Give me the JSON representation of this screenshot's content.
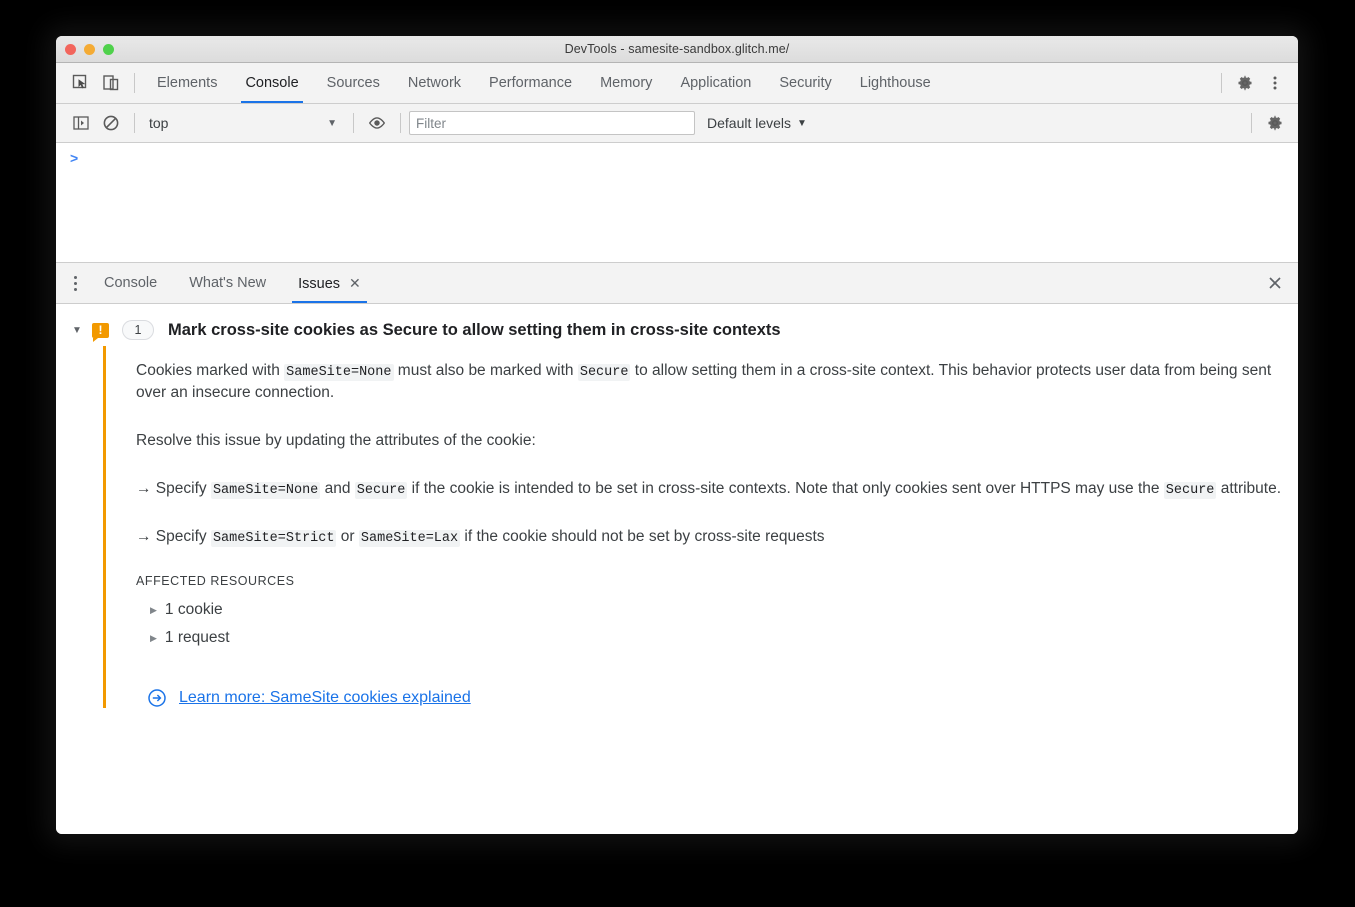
{
  "window": {
    "title": "DevTools - samesite-sandbox.glitch.me/",
    "traffic_lights": [
      "close",
      "minimize",
      "maximize"
    ],
    "colors": {
      "accent_blue": "#1a73e8",
      "warning_orange": "#f29900",
      "link_blue": "#1a73e8",
      "chrome_gray": "#f3f3f3"
    }
  },
  "main_tabs": {
    "inspect_icon": "inspect-cursor-icon",
    "device_icon": "device-toolbar-icon",
    "items": [
      {
        "label": "Elements",
        "active": false
      },
      {
        "label": "Console",
        "active": true
      },
      {
        "label": "Sources",
        "active": false
      },
      {
        "label": "Network",
        "active": false
      },
      {
        "label": "Performance",
        "active": false
      },
      {
        "label": "Memory",
        "active": false
      },
      {
        "label": "Application",
        "active": false
      },
      {
        "label": "Security",
        "active": false
      },
      {
        "label": "Lighthouse",
        "active": false
      }
    ],
    "settings_icon": "gear-icon",
    "more_icon": "vertical-dots-icon"
  },
  "console_toolbar": {
    "sidebar_icon": "console-sidebar-icon",
    "clear_icon": "clear-console-icon",
    "context": "top",
    "context_caret": "▼",
    "eye_icon": "live-expression-eye-icon",
    "filter_placeholder": "Filter",
    "filter_value": "",
    "levels": "Default levels",
    "levels_caret": "▼",
    "settings_icon": "gear-icon"
  },
  "console_area": {
    "prompt": ">"
  },
  "drawer": {
    "menu_icon": "vertical-dots-icon",
    "tabs": [
      {
        "label": "Console",
        "active": false,
        "closable": false
      },
      {
        "label": "What's New",
        "active": false,
        "closable": false
      },
      {
        "label": "Issues",
        "active": true,
        "closable": true,
        "close_glyph": "✕"
      }
    ],
    "close_drawer_glyph": "✕"
  },
  "issue": {
    "disclosure_glyph": "▼",
    "severity_icon": "warning-badge-icon",
    "severity_glyph": "!",
    "count": "1",
    "title": "Mark cross-site cookies as Secure to allow setting them in cross-site contexts",
    "paragraph1": {
      "part1": "Cookies marked with ",
      "code1": "SameSite=None",
      "part2": " must also be marked with ",
      "code2": "Secure",
      "part3": " to allow setting them in a cross-site context. This behavior protects user data from being sent over an insecure connection."
    },
    "paragraph2": "Resolve this issue by updating the attributes of the cookie:",
    "bullet1": {
      "arrow": "→",
      "part1": " Specify ",
      "code1": "SameSite=None",
      "part2": " and ",
      "code2": "Secure",
      "part3": " if the cookie is intended to be set in cross-site contexts. Note that only cookies sent over HTTPS may use the ",
      "code3": "Secure",
      "part4": " attribute."
    },
    "bullet2": {
      "arrow": "→",
      "part1": " Specify ",
      "code1": "SameSite=Strict",
      "part2": " or ",
      "code2": "SameSite=Lax",
      "part3": " if the cookie should not be set by cross-site requests"
    },
    "affected_resources_label": "AFFECTED RESOURCES",
    "resources": [
      {
        "triangle": "▶",
        "label": "1 cookie"
      },
      {
        "triangle": "▶",
        "label": "1 request"
      }
    ],
    "learn_more": {
      "icon": "external-link-circle-arrow-icon",
      "label": "Learn more: SameSite cookies explained"
    }
  }
}
